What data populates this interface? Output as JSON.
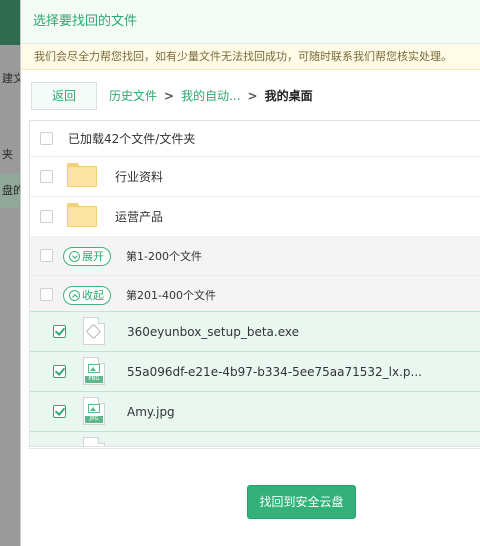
{
  "background_app": {
    "row1": "建文",
    "row2": "夹",
    "row3": "盘的"
  },
  "dialog": {
    "title": "选择要找回的文件",
    "notice": "我们会尽全力帮您找回，如有少量文件无法找回成功，可随时联系我们帮您核实处理。",
    "back_label": "返回",
    "breadcrumb": {
      "history": "历史文件",
      "sep1": ">",
      "auto": "我的自动...",
      "sep2": ">",
      "current": "我的桌面"
    },
    "loaded_text": "已加载42个文件/文件夹",
    "folders": [
      {
        "name": "行业资料"
      },
      {
        "name": "运营产品"
      }
    ],
    "groups": [
      {
        "toggle": "展开",
        "label": "第1-200个文件"
      },
      {
        "toggle": "收起",
        "label": "第201-400个文件"
      }
    ],
    "files": [
      {
        "name": "360eyunbox_setup_beta.exe",
        "icon": "exe-file-icon",
        "tag": ""
      },
      {
        "name": "55a096df-e21e-4b97-b334-5ee75aa71532_lx.p...",
        "icon": "png-file-icon",
        "tag": "PNG"
      },
      {
        "name": "Amy.jpg",
        "icon": "jpg-file-icon",
        "tag": "JPG"
      }
    ],
    "recover_label": "找回到安全云盘"
  },
  "colors": {
    "accent": "#33b17a",
    "link": "#2ca970",
    "selected_row": "#e9f7f0",
    "notice_bg": "#fffbe6"
  }
}
